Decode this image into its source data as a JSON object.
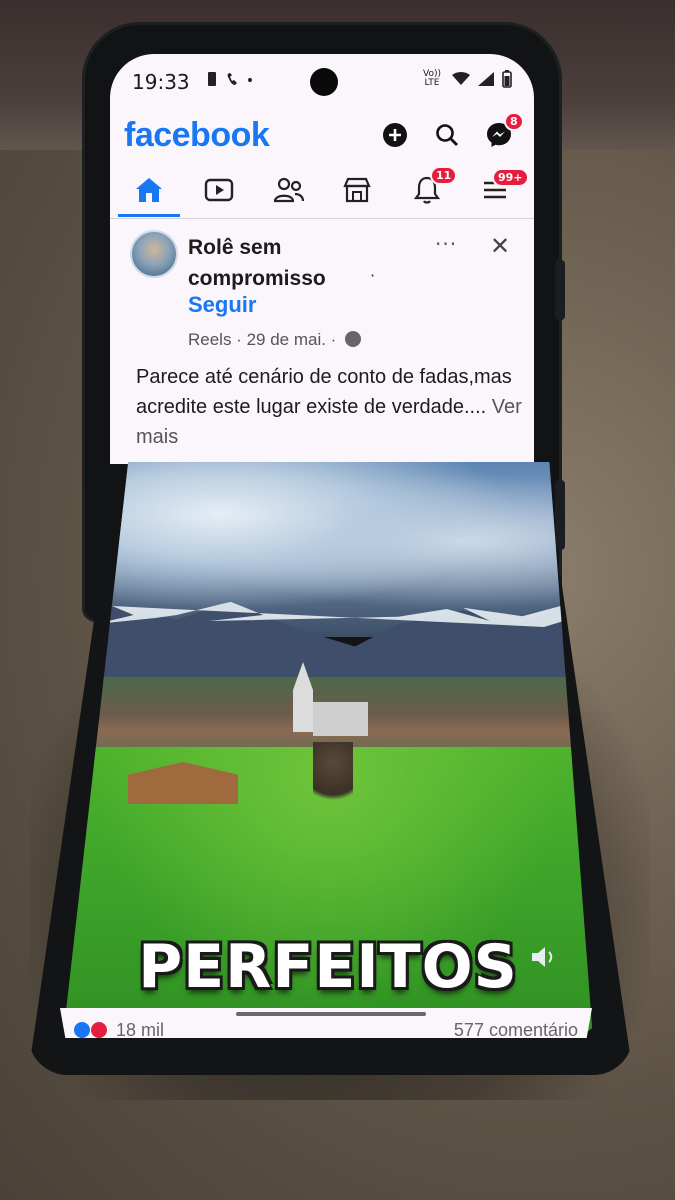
{
  "status_bar": {
    "time": "19:33",
    "network_label": "Vo)) LTE"
  },
  "app": {
    "logo": "facebook",
    "notification_badge": "11",
    "menu_badge": "99+",
    "messenger_badge": "8"
  },
  "nav": {
    "items": [
      "home-icon",
      "video-icon",
      "friends-icon",
      "marketplace-icon",
      "notifications-icon",
      "menu-icon"
    ],
    "active": "home"
  },
  "post": {
    "author": "Rolê sem compromisso",
    "separator": "·",
    "follow_label": "Seguir",
    "meta": "Reels · 29 de mai. ·",
    "text": "Parece até cenário de conto de fadas,mas acredite este lugar existe de verdade....",
    "see_more": "Ver mais",
    "more_options": "···",
    "close": "✕"
  },
  "video": {
    "caption": "PERFEITOS"
  },
  "stats": {
    "reactions": "18 mil",
    "comments": "577 comentário"
  },
  "colors": {
    "brand": "#1877f2",
    "badge": "#e41e3f"
  }
}
